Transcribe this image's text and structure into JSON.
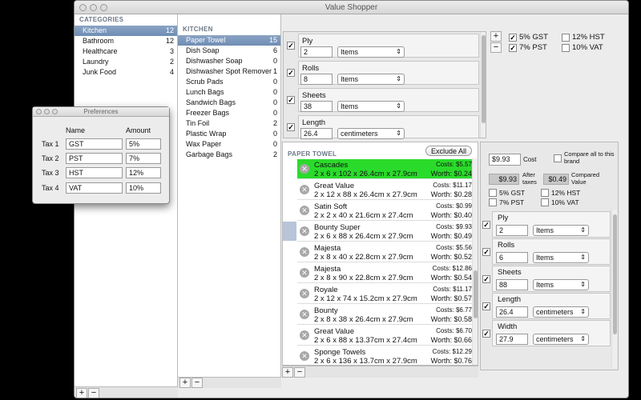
{
  "app": {
    "title": "Value Shopper"
  },
  "categories": {
    "header": "CATEGORIES",
    "items": [
      {
        "label": "Kitchen",
        "count": "12"
      },
      {
        "label": "Bathroom",
        "count": "12"
      },
      {
        "label": "Healthcare",
        "count": "3"
      },
      {
        "label": "Laundry",
        "count": "2"
      },
      {
        "label": "Junk Food",
        "count": "4"
      }
    ],
    "add": "+",
    "remove": "−"
  },
  "subcategories": {
    "header": "KITCHEN",
    "items": [
      {
        "label": "Paper Towel",
        "count": "15"
      },
      {
        "label": "Dish Soap",
        "count": "6"
      },
      {
        "label": "Dishwasher Soap",
        "count": "0"
      },
      {
        "label": "Dishwasher Spot Remover",
        "count": "1"
      },
      {
        "label": "Scrub Pads",
        "count": "0"
      },
      {
        "label": "Lunch Bags",
        "count": "0"
      },
      {
        "label": "Sandwich Bags",
        "count": "0"
      },
      {
        "label": "Freezer Bags",
        "count": "0"
      },
      {
        "label": "Tin Foil",
        "count": "2"
      },
      {
        "label": "Plastic Wrap",
        "count": "0"
      },
      {
        "label": "Wax Paper",
        "count": "0"
      },
      {
        "label": "Garbage Bags",
        "count": "2"
      }
    ],
    "add": "+",
    "remove": "−"
  },
  "attributes": [
    {
      "name": "Ply",
      "value": "2",
      "unit": "Items"
    },
    {
      "name": "Rolls",
      "value": "8",
      "unit": "Items"
    },
    {
      "name": "Sheets",
      "value": "38",
      "unit": "Items"
    },
    {
      "name": "Length",
      "value": "26.4",
      "unit": "centimeters"
    }
  ],
  "taxes_top": {
    "add": "+",
    "remove": "−",
    "items": [
      {
        "label": "5% GST",
        "checked": true
      },
      {
        "label": "12% HST",
        "checked": false
      },
      {
        "label": "7% PST",
        "checked": true
      },
      {
        "label": "10% VAT",
        "checked": false
      }
    ]
  },
  "products": {
    "header": "PAPER TOWEL",
    "exclude_all": "Exclude All",
    "add": "+",
    "remove": "−",
    "items": [
      {
        "name": "Cascades",
        "dims": "2 x 6 x 102 x 26.4cm x 27.9cm",
        "cost": "Costs: $5.57",
        "worth": "Worth: $0.24"
      },
      {
        "name": "Great Value",
        "dims": "2 x 12 x 88 x 26.4cm x 27.9cm",
        "cost": "Costs: $11.17",
        "worth": "Worth: $0.28"
      },
      {
        "name": "Satin Soft",
        "dims": "2 x 2 x 40 x 21.6cm x 27.4cm",
        "cost": "Costs: $0.99",
        "worth": "Worth: $0.40"
      },
      {
        "name": "Bounty Super",
        "dims": "2 x 6 x 88 x 26.4cm x 27.9cm",
        "cost": "Costs: $9.93",
        "worth": "Worth: $0.49"
      },
      {
        "name": "Majesta",
        "dims": "2 x 8 x 40 x 22.8cm x 27.9cm",
        "cost": "Costs: $5.56",
        "worth": "Worth: $0.52"
      },
      {
        "name": "Majesta",
        "dims": "2 x 8 x 90 x 22.8cm x 27.9cm",
        "cost": "Costs: $12.86",
        "worth": "Worth: $0.54"
      },
      {
        "name": "Royale",
        "dims": "2 x 12 x 74 x 15.2cm x 27.9cm",
        "cost": "Costs: $11.17",
        "worth": "Worth: $0.57"
      },
      {
        "name": "Bounty",
        "dims": "2 x 8 x 38 x 26.4cm x 27.9cm",
        "cost": "Costs: $6.77",
        "worth": "Worth: $0.58"
      },
      {
        "name": "Great Value",
        "dims": "2 x 6 x 88 x 13.37cm x 27.4cm",
        "cost": "Costs: $6.70",
        "worth": "Worth: $0.66"
      },
      {
        "name": "Sponge Towels",
        "dims": "2 x 6 x 136 x 13.7cm x 27.9cm",
        "cost": "Costs: $12.29",
        "worth": "Worth: $0.76"
      }
    ]
  },
  "detail": {
    "cost_value": "$9.93",
    "cost_label": "Cost",
    "compare_label": "Compare all to this brand",
    "after_value": "$9.93",
    "after_label": "After taxes",
    "compared_value": "$0.49",
    "compared_label": "Compared Value",
    "taxes": [
      {
        "label": "5% GST",
        "checked": false
      },
      {
        "label": "12% HST",
        "checked": false
      },
      {
        "label": "7% PST",
        "checked": false
      },
      {
        "label": "10% VAT",
        "checked": false
      }
    ],
    "attributes": [
      {
        "name": "Ply",
        "value": "2",
        "unit": "Items"
      },
      {
        "name": "Rolls",
        "value": "6",
        "unit": "Items"
      },
      {
        "name": "Sheets",
        "value": "88",
        "unit": "Items"
      },
      {
        "name": "Length",
        "value": "26.4",
        "unit": "centimeters"
      },
      {
        "name": "Width",
        "value": "27.9",
        "unit": "centimeters"
      }
    ]
  },
  "preferences": {
    "title": "Preferences",
    "col_name": "Name",
    "col_amount": "Amount",
    "rows": [
      {
        "label": "Tax 1",
        "name": "GST",
        "amount": "5%"
      },
      {
        "label": "Tax 2",
        "name": "PST",
        "amount": "7%"
      },
      {
        "label": "Tax 3",
        "name": "HST",
        "amount": "12%"
      },
      {
        "label": "Tax 4",
        "name": "VAT",
        "amount": "10%"
      }
    ]
  },
  "colors": {
    "selection": "#7a95bb",
    "best_value": "#2bdb2b"
  }
}
